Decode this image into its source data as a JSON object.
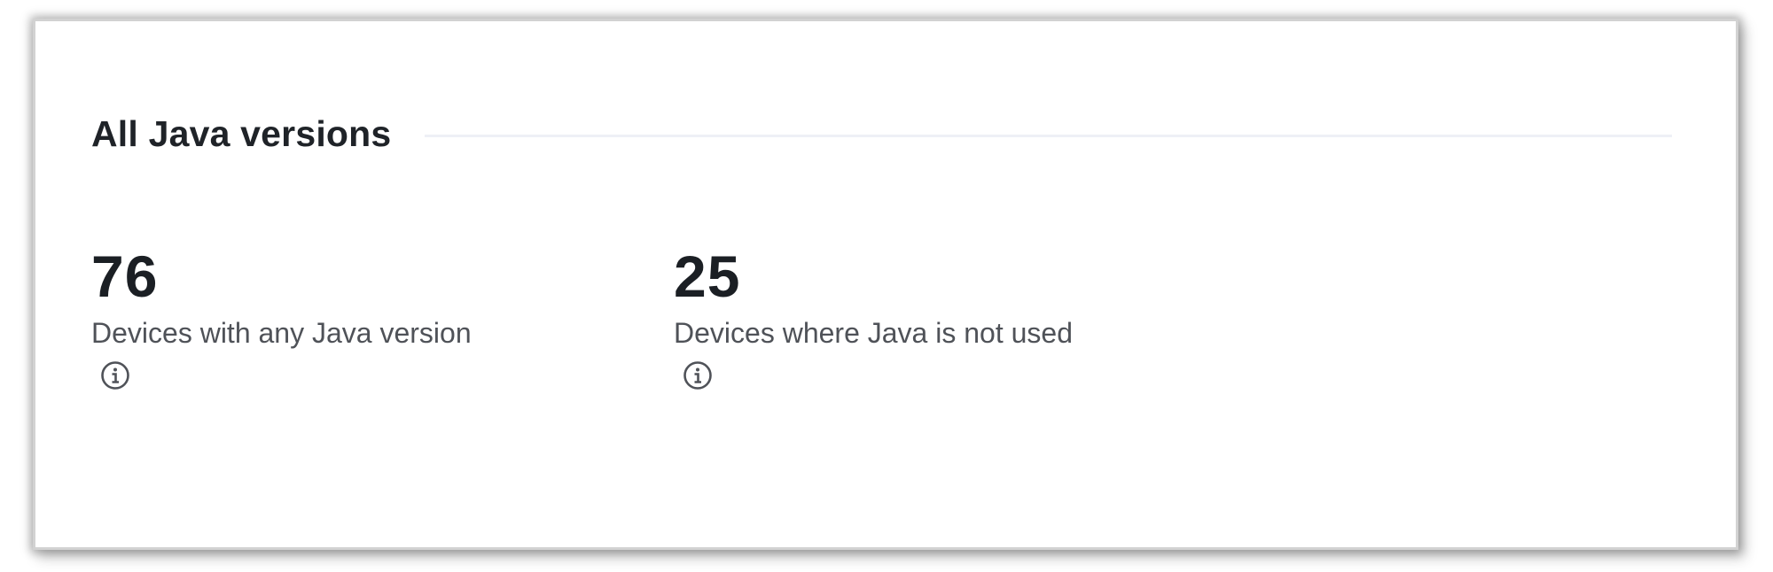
{
  "card": {
    "title": "All Java versions"
  },
  "metrics": [
    {
      "value": "76",
      "description": "Devices with any Java version",
      "icon": "info-icon"
    },
    {
      "value": "25",
      "description": "Devices where Java is not used",
      "icon": "info-icon"
    }
  ]
}
